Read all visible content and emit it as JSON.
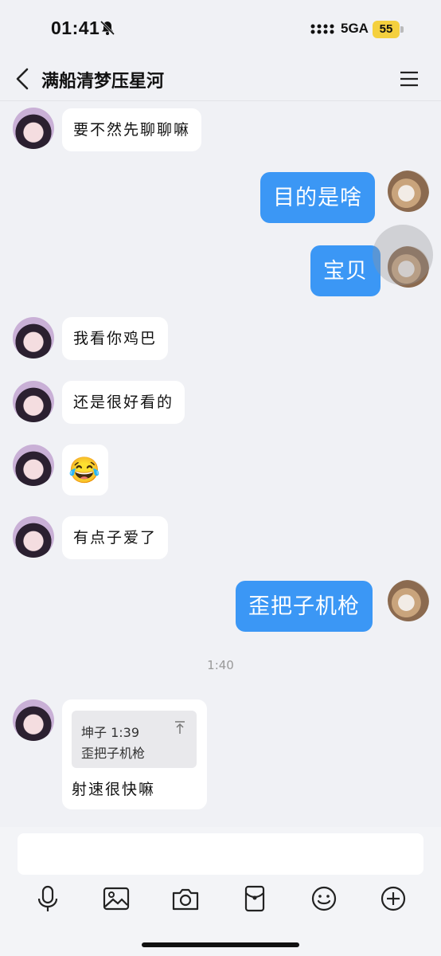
{
  "status": {
    "time": "01:41",
    "network": "5GA",
    "battery": "55"
  },
  "chat": {
    "title": "满船清梦压星河"
  },
  "messages": [
    {
      "text": "要不然先聊聊嘛"
    },
    {
      "text": "目的是啥"
    },
    {
      "text": "宝贝"
    },
    {
      "text": "我看你鸡巴"
    },
    {
      "text": "还是很好看的"
    },
    {
      "text": "😂"
    },
    {
      "text": "有点子爱了"
    },
    {
      "text": "歪把子机枪"
    }
  ],
  "timestamp": "1:40",
  "quote": {
    "meta": "坤子 1:39",
    "text": "歪把子机枪",
    "reply": "射速很快嘛"
  },
  "toolbar": {
    "icons": [
      "mic-icon",
      "image-icon",
      "camera-icon",
      "red-packet-icon",
      "emoji-icon",
      "plus-icon"
    ]
  }
}
